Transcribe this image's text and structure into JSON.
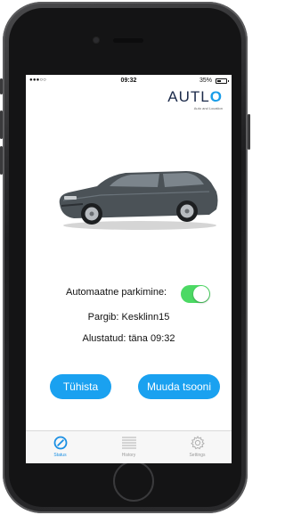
{
  "status_bar": {
    "signal": "●●●○○",
    "time": "09:32",
    "battery": "35%"
  },
  "logo": {
    "text_start": "AUTL",
    "text_end": "O",
    "tagline": "Auto and Location"
  },
  "parking": {
    "label": "Automaatne parkimine:",
    "toggle_on": true
  },
  "zone_text": "Pargib: Kesklinn15",
  "started_text": "Alustatud: täna 09:32",
  "buttons": {
    "cancel": "Tühista",
    "change_zone": "Muuda tsooni"
  },
  "tabs": [
    {
      "label": "Status",
      "icon": "status-icon",
      "active": true
    },
    {
      "label": "History",
      "icon": "history-icon",
      "active": false
    },
    {
      "label": "Settings",
      "icon": "settings-icon",
      "active": false
    }
  ],
  "colors": {
    "accent": "#1aa1f0",
    "toggle": "#4cd964",
    "logo_dark": "#1b2a4a"
  }
}
